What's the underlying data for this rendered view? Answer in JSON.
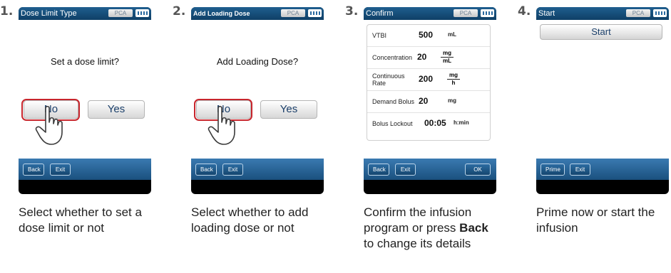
{
  "steps": [
    {
      "number": "1.",
      "title": "Dose Limit Type",
      "pca": "PCA",
      "question": "Set a dose limit?",
      "no": "No",
      "yes": "Yes",
      "back": "Back",
      "exit": "Exit",
      "caption": "Select whether to set a dose limit or not"
    },
    {
      "number": "2.",
      "title": "Add Loading Dose",
      "pca": "PCA",
      "question": "Add Loading Dose?",
      "no": "No",
      "yes": "Yes",
      "back": "Back",
      "exit": "Exit",
      "caption": "Select whether to add loading dose or not"
    },
    {
      "number": "3.",
      "title": "Confirm",
      "pca": "PCA",
      "rows": [
        {
          "label": "VTBI",
          "value": "500",
          "unit": "mL"
        },
        {
          "label": "Concentration",
          "value": "20",
          "unit_num": "mg",
          "unit_den": "mL"
        },
        {
          "label": "Continuous Rate",
          "value": "200",
          "unit_num": "mg",
          "unit_den": "h"
        },
        {
          "label": "Demand Bolus",
          "value": "20",
          "unit": "mg"
        },
        {
          "label": "Bolus Lockout",
          "value": "00:05",
          "unit": "h:min"
        }
      ],
      "back": "Back",
      "exit": "Exit",
      "ok": "OK",
      "caption_before": "Confirm the infusion program or press ",
      "caption_bold": "Back",
      "caption_after": " to change its details"
    },
    {
      "number": "4.",
      "title": "Start",
      "pca": "PCA",
      "start": "Start",
      "prime": "Prime",
      "exit": "Exit",
      "caption": "Prime now or start the infusion"
    }
  ],
  "colors": {
    "titlebar": "#1f5f8f",
    "bottombar": "#2a6aa0",
    "highlight": "#c8262d",
    "button_text": "#1b3f6a"
  },
  "icons": [
    "battery-icon",
    "pointing-hand-icon"
  ]
}
